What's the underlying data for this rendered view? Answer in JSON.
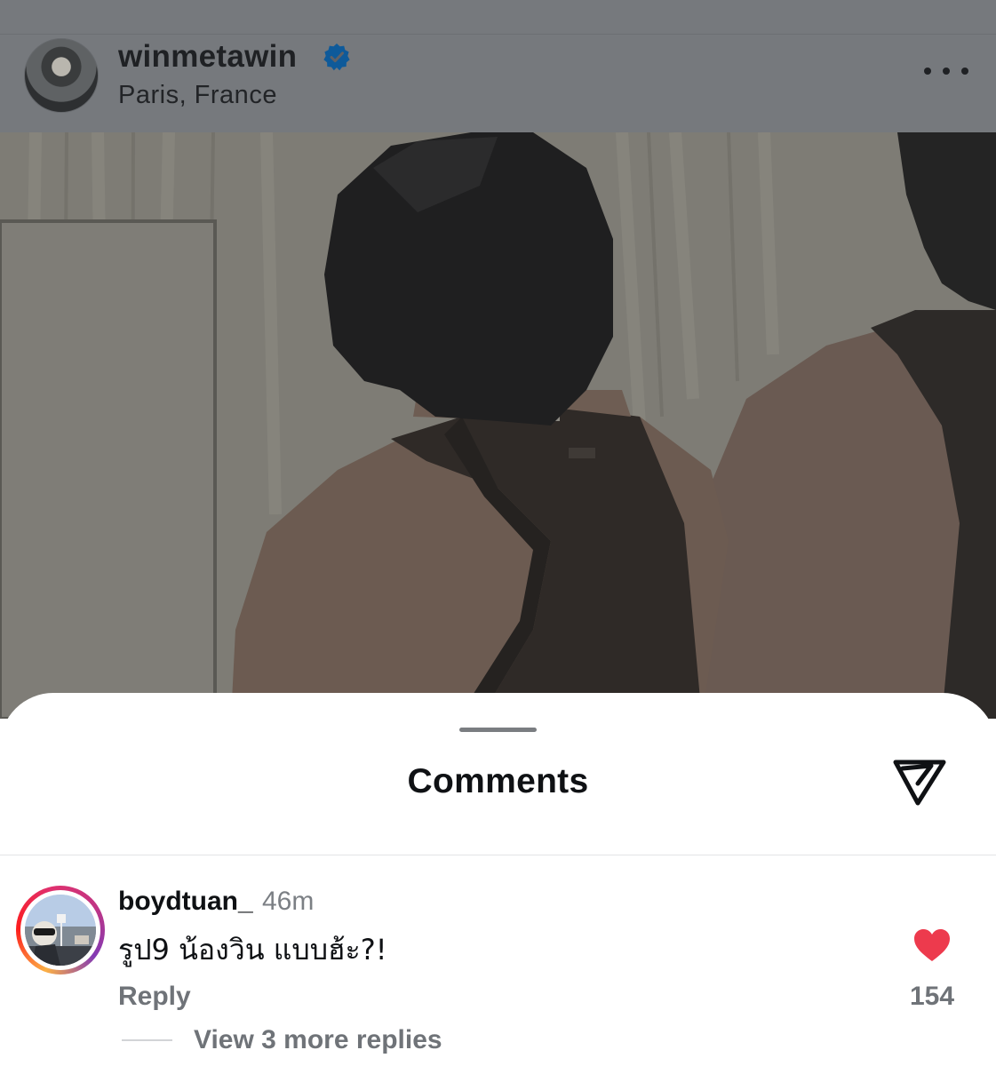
{
  "post": {
    "username": "winmetawin",
    "verified": true,
    "location": "Paris, France",
    "more_icon": "more-horizontal-icon",
    "photo_subject": "photo"
  },
  "comments_sheet": {
    "title": "Comments",
    "share_icon": "send-icon",
    "comments": [
      {
        "username": "boydtuan_",
        "time": "46m",
        "text": "รูป9 น้องวิน แบบฮ้ะ?!",
        "reply_label": "Reply",
        "liked": true,
        "like_count": "154",
        "view_replies_label": "View 3 more replies"
      }
    ]
  },
  "colors": {
    "like_red": "#ed3a4d",
    "verified_blue": "#0e5a9a",
    "dim_overlay": "#76797d"
  }
}
